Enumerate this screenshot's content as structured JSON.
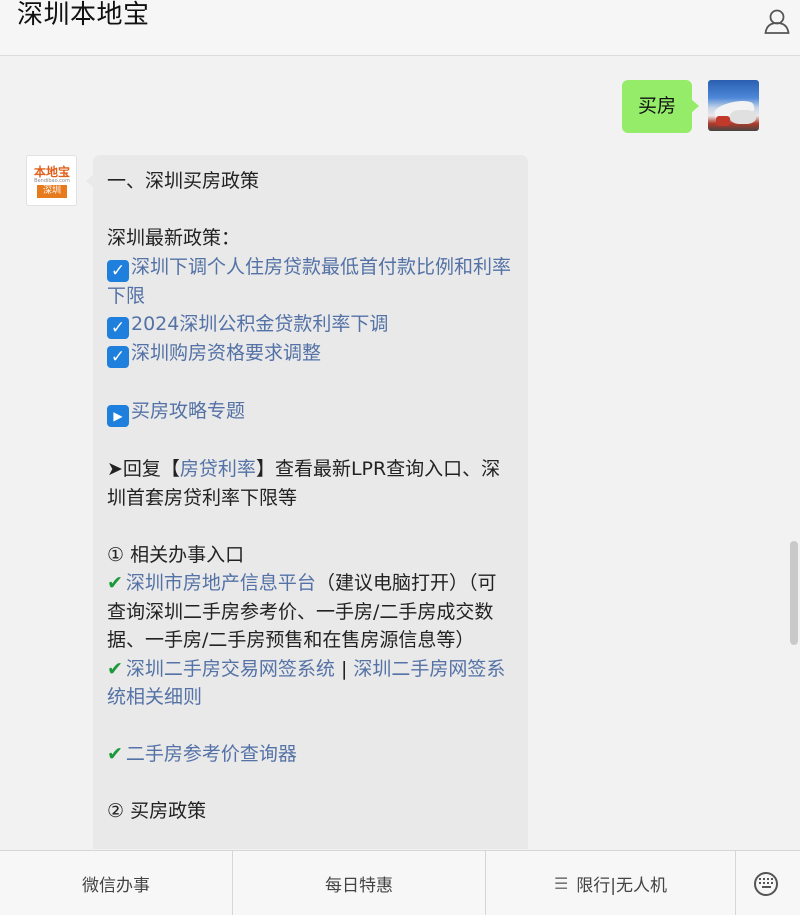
{
  "header": {
    "title": "深圳本地宝",
    "user_icon": "user-icon"
  },
  "outgoing": {
    "text": "买房"
  },
  "incoming": {
    "lines": [
      {
        "kind": "text",
        "text": "一、深圳买房政策"
      },
      {
        "kind": "blank"
      },
      {
        "kind": "text",
        "text": "深圳最新政策："
      },
      {
        "kind": "check-link",
        "text": "深圳下调个人住房贷款最低首付款比例和利率下限"
      },
      {
        "kind": "check-link",
        "text": "2024深圳公积金贷款利率下调"
      },
      {
        "kind": "check-link",
        "text": "深圳购房资格要求调整"
      },
      {
        "kind": "blank"
      },
      {
        "kind": "play-link",
        "text": "买房攻略专题"
      },
      {
        "kind": "blank"
      },
      {
        "kind": "reply",
        "prefix": "➤回复【",
        "link": "房贷利率",
        "suffix": "】查看最新LPR查询入口、深圳首套房贷利率下限等"
      },
      {
        "kind": "blank"
      },
      {
        "kind": "text",
        "text": "① 相关办事入口"
      },
      {
        "kind": "tick-link-note",
        "link": "深圳市房地产信息平台",
        "note": "（建议电脑打开）（可查询深圳二手房参考价、一手房/二手房成交数据、一手房/二手房预售和在售房源信息等）"
      },
      {
        "kind": "tick-two-links",
        "link1": "深圳二手房交易网签系统",
        "sep": " | ",
        "link2": "深圳二手房网签系统相关细则"
      },
      {
        "kind": "blank"
      },
      {
        "kind": "tick-link",
        "text": "二手房参考价查询器"
      },
      {
        "kind": "blank"
      },
      {
        "kind": "text",
        "text": "② 买房政策"
      }
    ]
  },
  "bottom_menu": {
    "items": [
      "微信办事",
      "每日特惠",
      "限行|无人机"
    ],
    "keyboard_icon": "keyboard-icon"
  },
  "colors": {
    "link": "#5472a6",
    "outgoing_bubble": "#95ec69",
    "incoming_bubble": "#e9e9e9",
    "check": "#1f7fdc",
    "tick": "#1a9a3a"
  }
}
